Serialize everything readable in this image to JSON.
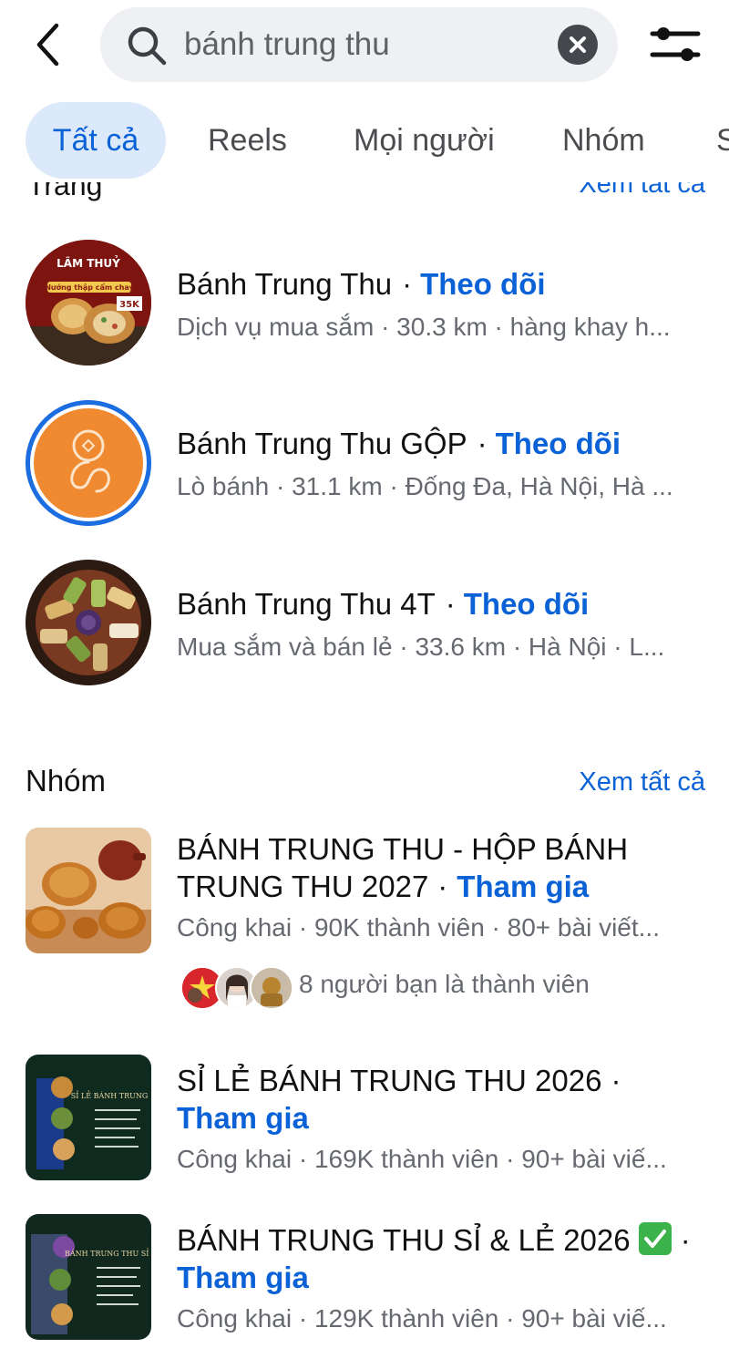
{
  "search": {
    "query": "bánh trung thu"
  },
  "tabs": [
    {
      "label": "Tất cả",
      "active": true
    },
    {
      "label": "Reels"
    },
    {
      "label": "Mọi người"
    },
    {
      "label": "Nhóm"
    },
    {
      "label": "S"
    }
  ],
  "pages_section": {
    "title_fragment": "Trang",
    "see_all": "Xem tất cả",
    "items": [
      {
        "name": "Bánh Trung Thu",
        "action": "Theo dõi",
        "subtitle": "Dịch vụ mua sắm · 30.3 km · hàng khay h...",
        "avatar_text": [
          "LÂM THUỶ",
          "Nướng thập cẩm chay",
          "35K"
        ]
      },
      {
        "name": "Bánh Trung Thu GỘP",
        "action": "Theo dõi",
        "subtitle": "Lò bánh · 31.1 km · Đống Đa, Hà Nội, Hà ..."
      },
      {
        "name": "Bánh Trung Thu 4T",
        "action": "Theo dõi",
        "subtitle": "Mua sắm và bán lẻ · 33.6 km · Hà Nội · L..."
      }
    ]
  },
  "groups_section": {
    "title": "Nhóm",
    "see_all": "Xem tất cả",
    "items": [
      {
        "name_line1": "BÁNH TRUNG THU - HỘP BÁNH",
        "name_line2": "TRUNG THU 2027",
        "action": "Tham gia",
        "subtitle": "Công khai · 90K thành viên · 80+ bài viết...",
        "friends_text": "8 người bạn là thành viên"
      },
      {
        "name_line1": "SỈ LẺ BÁNH TRUNG THU 2026",
        "action": "Tham gia",
        "subtitle": "Công khai · 169K thành viên · 90+ bài viế...",
        "thumb_title": "SỈ LẺ BÁNH TRUNG"
      },
      {
        "name_line1": "BÁNH TRUNG THU SỈ & LẺ 2026",
        "action": "Tham gia",
        "subtitle": "Công khai · 129K thành viên · 90+ bài viế...",
        "thumb_title": "BÁNH TRUNG THU SỈ &"
      }
    ]
  },
  "colors": {
    "accent": "#0a62d6",
    "active_tab_bg": "#dbe9fa",
    "search_bg": "#eef0f3",
    "secondary_text": "#666a70"
  }
}
